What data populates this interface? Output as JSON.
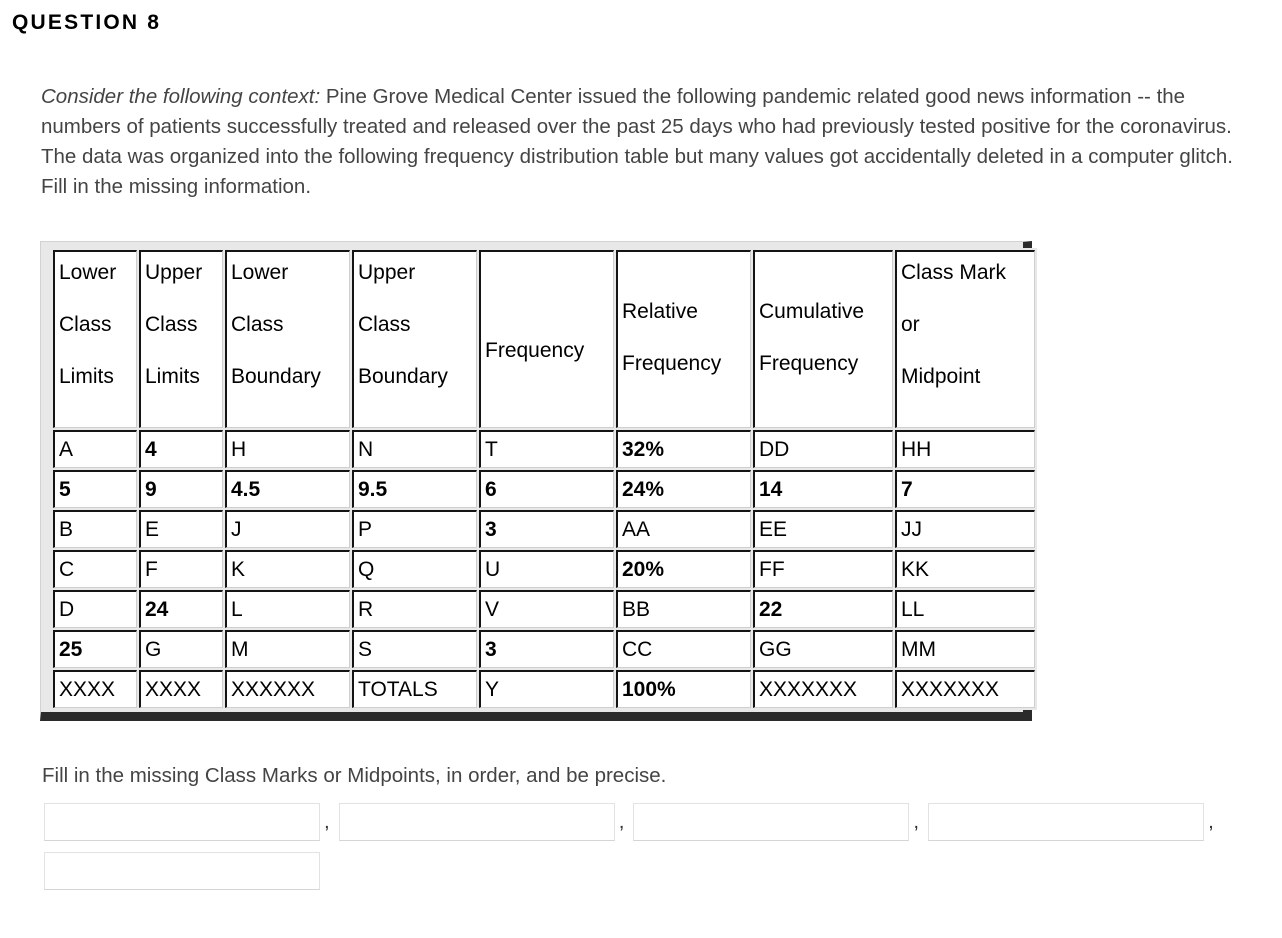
{
  "heading": "QUESTION 8",
  "prompt": {
    "lead": "Consider the following context:",
    "body": " Pine Grove Medical Center issued the following pandemic related good news information -- the numbers of patients successfully treated and released over the past 25 days who had previously tested positive for the coronavirus.  The data was organized into the following frequency distribution table but many values got accidentally deleted in a computer glitch.  Fill in the missing information."
  },
  "table": {
    "headers": [
      {
        "lines": [
          "Lower",
          "Class",
          "Limits"
        ]
      },
      {
        "lines": [
          "Upper",
          "Class",
          "Limits"
        ]
      },
      {
        "lines": [
          "Lower",
          "Class",
          "Boundary"
        ]
      },
      {
        "lines": [
          "Upper",
          "Class",
          "Boundary"
        ]
      },
      {
        "lines": [
          "Frequency"
        ]
      },
      {
        "lines": [
          "Relative",
          "Frequency"
        ]
      },
      {
        "lines": [
          "Cumulative",
          "Frequency"
        ]
      },
      {
        "lines": [
          "Class Mark",
          "or",
          "Midpoint"
        ]
      }
    ],
    "rows": [
      [
        {
          "text": "A",
          "bold": false
        },
        {
          "text": "4",
          "bold": true
        },
        {
          "text": "H",
          "bold": false
        },
        {
          "text": "N",
          "bold": false
        },
        {
          "text": "T",
          "bold": false
        },
        {
          "text": "32%",
          "bold": true
        },
        {
          "text": "DD",
          "bold": false
        },
        {
          "text": "HH",
          "bold": false
        }
      ],
      [
        {
          "text": "5",
          "bold": true
        },
        {
          "text": "9",
          "bold": true
        },
        {
          "text": "4.5",
          "bold": true
        },
        {
          "text": "9.5",
          "bold": true
        },
        {
          "text": "6",
          "bold": true
        },
        {
          "text": "24%",
          "bold": true
        },
        {
          "text": "14",
          "bold": true
        },
        {
          "text": "7",
          "bold": true
        }
      ],
      [
        {
          "text": "B",
          "bold": false
        },
        {
          "text": "E",
          "bold": false
        },
        {
          "text": "J",
          "bold": false
        },
        {
          "text": "P",
          "bold": false
        },
        {
          "text": "3",
          "bold": true
        },
        {
          "text": "AA",
          "bold": false
        },
        {
          "text": "EE",
          "bold": false
        },
        {
          "text": "JJ",
          "bold": false
        }
      ],
      [
        {
          "text": "C",
          "bold": false
        },
        {
          "text": "F",
          "bold": false
        },
        {
          "text": "K",
          "bold": false
        },
        {
          "text": "Q",
          "bold": false
        },
        {
          "text": "U",
          "bold": false
        },
        {
          "text": "20%",
          "bold": true
        },
        {
          "text": "FF",
          "bold": false
        },
        {
          "text": "KK",
          "bold": false
        }
      ],
      [
        {
          "text": "D",
          "bold": false
        },
        {
          "text": "24",
          "bold": true
        },
        {
          "text": "L",
          "bold": false
        },
        {
          "text": "R",
          "bold": false
        },
        {
          "text": "V",
          "bold": false
        },
        {
          "text": "BB",
          "bold": false
        },
        {
          "text": "22",
          "bold": true
        },
        {
          "text": "LL",
          "bold": false
        }
      ],
      [
        {
          "text": "25",
          "bold": true
        },
        {
          "text": "G",
          "bold": false
        },
        {
          "text": "M",
          "bold": false
        },
        {
          "text": "S",
          "bold": false
        },
        {
          "text": "3",
          "bold": true
        },
        {
          "text": "CC",
          "bold": false
        },
        {
          "text": "GG",
          "bold": false
        },
        {
          "text": "MM",
          "bold": false
        }
      ],
      [
        {
          "text": "XXXX",
          "bold": false
        },
        {
          "text": "XXXX",
          "bold": false
        },
        {
          "text": "XXXXXX",
          "bold": false
        },
        {
          "text": "TOTALS",
          "bold": false
        },
        {
          "text": "Y",
          "bold": false
        },
        {
          "text": "100%",
          "bold": true
        },
        {
          "text": "XXXXXXX",
          "bold": false
        },
        {
          "text": "XXXXXXX",
          "bold": false
        }
      ]
    ]
  },
  "answer": {
    "instruction": "Fill in the missing Class Marks or Midpoints, in order, and be precise.",
    "separator": ",",
    "fields": [
      {
        "value": "",
        "placeholder": ""
      },
      {
        "value": "",
        "placeholder": ""
      },
      {
        "value": "",
        "placeholder": ""
      },
      {
        "value": "",
        "placeholder": ""
      },
      {
        "value": "",
        "placeholder": ""
      }
    ]
  },
  "colors": {
    "text": "#444444",
    "heading": "#000000",
    "cell_border": "#141414",
    "frame_shadow": "#2b2b2b",
    "input_border": "#e2e2e2"
  }
}
